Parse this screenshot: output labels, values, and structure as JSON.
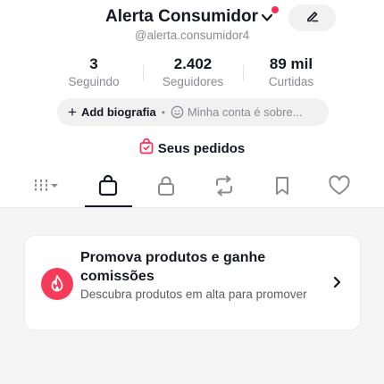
{
  "profile": {
    "name": "Alerta Consumidor",
    "handle": "@alerta.consumidor4"
  },
  "stats": [
    {
      "value": "3",
      "label": "Seguindo"
    },
    {
      "value": "2.402",
      "label": "Seguidores"
    },
    {
      "value": "89 mil",
      "label": "Curtidas"
    }
  ],
  "bio": {
    "add_label": "Add biografia",
    "separator": "•",
    "suggestion": "Minha conta é sobre..."
  },
  "orders": {
    "label": "Seus pedidos"
  },
  "tabs": [
    {
      "icon": "grid-icon"
    },
    {
      "icon": "shopping-bag-icon",
      "active": true
    },
    {
      "icon": "lock-icon"
    },
    {
      "icon": "repost-icon"
    },
    {
      "icon": "bookmark-icon"
    },
    {
      "icon": "heart-icon"
    }
  ],
  "promo_card": {
    "title": "Promova produtos e ganhe comissões",
    "subtitle": "Descubra produtos em alta para promover"
  },
  "colors": {
    "accent": "#fe2c55",
    "text": "#161823",
    "muted": "#8a8b91",
    "pill_bg": "#f1f1f2"
  }
}
